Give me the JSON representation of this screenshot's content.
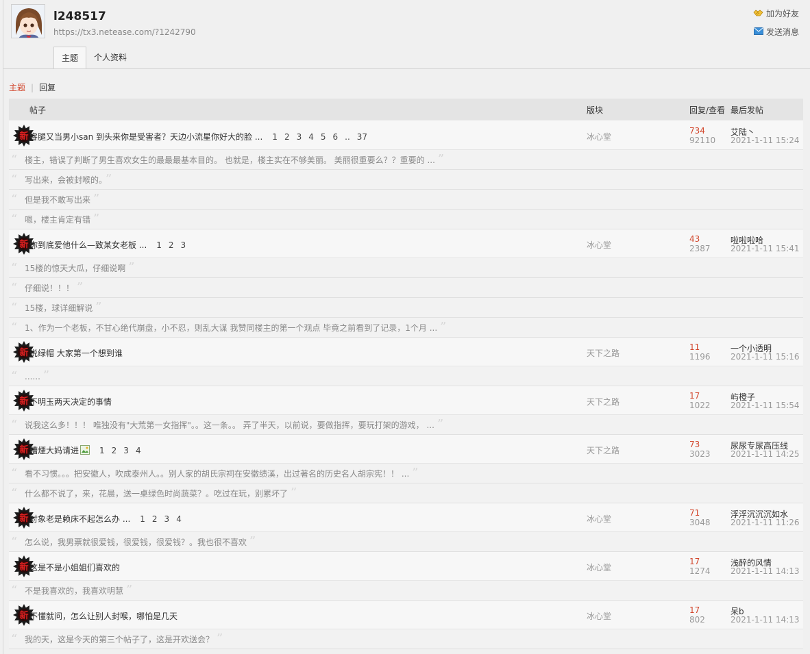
{
  "user": {
    "name": "l248517",
    "url": "https://tx3.netease.com/?1242790"
  },
  "actions": {
    "add_friend": "加为好友",
    "send_message": "发送消息"
  },
  "tabs": [
    "主题",
    "个人资料"
  ],
  "filter": {
    "active": "主题",
    "separator": "|",
    "other": "回复"
  },
  "table_header": {
    "post": "帖子",
    "board": "版块",
    "reply_view": "回复/查看",
    "last_post": "最后发帖"
  },
  "badge_text": "新",
  "threads": [
    {
      "title": "睿腿又当男小san 到头来你是受害者？天边小流星你好大的脸 ...",
      "pages": [
        "1",
        "2",
        "3",
        "4",
        "5",
        "6",
        "..",
        "37"
      ],
      "board": "冰心堂",
      "replies": "734",
      "views": "92110",
      "last_user": "艾陆丶",
      "last_time": "2021-1-11 15:24",
      "replies_list": [
        "楼主，错误了判断了男生喜欢女生的最最最基本目的。 也就是，楼主实在不够美丽。 美丽很重要么？？重要的 ...",
        "写出来，会被封喉的。",
        "但是我不敢写出来",
        "嗯，楼主肯定有错"
      ]
    },
    {
      "title": "你到底爱他什么—致某女老板 ...",
      "pages": [
        "1",
        "2",
        "3"
      ],
      "board": "冰心堂",
      "replies": "43",
      "views": "2387",
      "last_user": "啦啦啦哈",
      "last_time": "2021-1-11 15:41",
      "replies_list": [
        "15楼的惊天大瓜，仔细说啊",
        "仔细说！！！",
        "15楼，球详细解说",
        "1、作为一个老板，不甘心绝代崩盘，小不忍，则乱大谋 我赞同楼主的第一个观点 毕竟之前看到了记录，1个月 ..."
      ]
    },
    {
      "title": "说绿帽 大家第一个想到谁",
      "pages": [],
      "board": "天下之路",
      "replies": "11",
      "views": "1196",
      "last_user": "一个小透明",
      "last_time": "2021-1-11 15:16",
      "replies_list": [
        "......"
      ]
    },
    {
      "title": "不明玉两天决定的事情",
      "pages": [],
      "board": "天下之路",
      "replies": "17",
      "views": "1022",
      "last_user": "屿橙子",
      "last_time": "2021-1-11 15:54",
      "replies_list": [
        "说我这么多！！！ 唯独没有\"大荒第一女指挥\"。。这一条。。 弄了半天，以前说，要做指挥，要玩打架的游戏， ..."
      ]
    },
    {
      "title": "糟煙大妈请进",
      "has_image": true,
      "pages": [
        "1",
        "2",
        "3",
        "4"
      ],
      "board": "天下之路",
      "replies": "73",
      "views": "3023",
      "last_user": "尿尿专尿高压线",
      "last_time": "2021-1-11 14:25",
      "replies_list": [
        "看不习惯。。。把安徽人，吹成泰州人。。别人家的胡氏宗祠在安徽绩溪，出过著名的历史名人胡宗宪！！ ...",
        "什么都不说了，来，花晨，送一桌绿色时尚蔬菜？。吃过在玩，别累坏了"
      ]
    },
    {
      "title": "对象老是赖床不起怎么办 ...",
      "pages": [
        "1",
        "2",
        "3",
        "4"
      ],
      "board": "冰心堂",
      "replies": "71",
      "views": "3048",
      "last_user": "浮浮沉沉沉如水",
      "last_time": "2021-1-11 11:26",
      "replies_list": [
        "怎么说，我男票就很爱钱，很爱钱，很爱钱？。我也很不喜欢"
      ]
    },
    {
      "title": "这是不是小姐姐们喜欢的",
      "pages": [],
      "board": "冰心堂",
      "replies": "17",
      "views": "1274",
      "last_user": "浅醉的风情",
      "last_time": "2021-1-11 14:13",
      "replies_list": [
        "不是我喜欢的，我喜欢明慧"
      ]
    },
    {
      "title": "不懂就问，怎么让别人封喉，哪怕是几天",
      "pages": [],
      "board": "冰心堂",
      "replies": "17",
      "views": "802",
      "last_user": "呆b",
      "last_time": "2021-1-11 14:13",
      "replies_list": [
        "我的天，这是今天的第三个帖子了，这是开欢送会？"
      ]
    }
  ],
  "colors": {
    "accent": "#d2472d",
    "background": "#f0f0f0",
    "muted": "#999999"
  }
}
